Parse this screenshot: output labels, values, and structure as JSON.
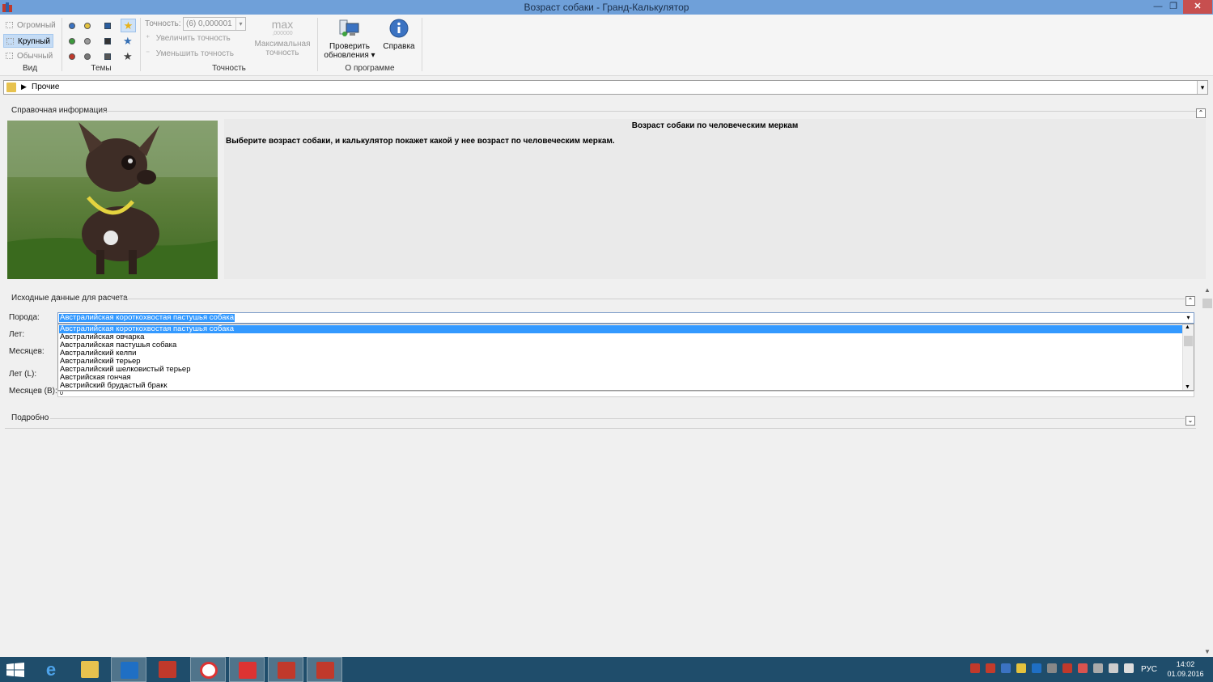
{
  "window": {
    "title": "Возраст собаки - Гранд-Калькулятор",
    "min_glyph": "—",
    "max_glyph": "❐",
    "close_glyph": "✕"
  },
  "ribbon": {
    "view": {
      "label": "Вид",
      "items": [
        "Огромный",
        "Крупный",
        "Обычный"
      ],
      "active": "Крупный"
    },
    "themes": {
      "label": "Темы"
    },
    "precision": {
      "label": "Точность",
      "field_label": "Точность:",
      "value": "(6)  0,000001",
      "increase": "Увеличить точность",
      "decrease": "Уменьшить точность",
      "max_icon_text": "max",
      "max_icon_sub": ",000000",
      "max_line1": "Максимальная",
      "max_line2": "точность"
    },
    "about": {
      "label": "О программе",
      "check_line1": "Проверить",
      "check_line2": "обновления ▾",
      "help": "Справка"
    }
  },
  "category_bar": {
    "category": "Прочие"
  },
  "reference": {
    "header": "Справочная информация",
    "title": "Возраст собаки по человеческим меркам",
    "text": "Выберите возраст собаки, и калькулятор покажет какой у нее возраст по человеческим меркам."
  },
  "inputs": {
    "header": "Исходные данные для расчета",
    "breed_label": "Порода:",
    "years_label": "Лет:",
    "months_label": "Месяцев:",
    "years_l_label": "Лет (L):",
    "months_b_label": "Месяцев (B):",
    "breed_selected": "Австралийская короткохвостая пастушья собака",
    "breed_options": [
      "Австралийская короткохвостая пастушья собака",
      "Австралийская овчарка",
      "Австралийская пастушья собака",
      "Австралийский келпи",
      "Австралийский терьер",
      "Австралийский шелковистый терьер",
      "Австрийская гончая",
      "Австрийский брудастый бракк"
    ],
    "months_b_value": "0"
  },
  "details": {
    "header": "Подробно"
  },
  "taskbar": {
    "lang": "РУС",
    "time": "14:02",
    "date": "01.09.2016"
  },
  "colors": {
    "titlebar": "#6fa0d9",
    "selection": "#3399ff",
    "taskbar": "#1f4d6b"
  }
}
